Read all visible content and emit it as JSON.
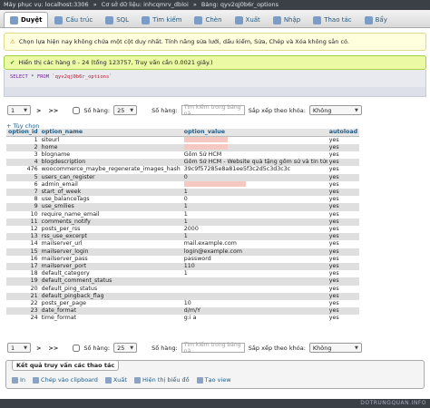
{
  "breadcrumb": {
    "server": "Máy phục vụ: localhost:3306",
    "database": "Cơ sở dữ liệu: inhcqmrv_dbloi",
    "table": "Bảng: qyv2qj0b6r_options",
    "sep": "»"
  },
  "tabs": [
    {
      "label": "Duyệt",
      "icon": "browse-icon"
    },
    {
      "label": "Cấu trúc",
      "icon": "structure-icon"
    },
    {
      "label": "SQL",
      "icon": "sql-icon"
    },
    {
      "label": "Tìm kiếm",
      "icon": "search-icon"
    },
    {
      "label": "Chèn",
      "icon": "insert-icon"
    },
    {
      "label": "Xuất",
      "icon": "export-icon"
    },
    {
      "label": "Nhập",
      "icon": "import-icon"
    },
    {
      "label": "Thao tác",
      "icon": "operations-icon"
    },
    {
      "label": "Bẩy",
      "icon": "triggers-icon"
    }
  ],
  "notice": "Chọn lựa hiện nay không chứa một cột duy nhất. Tính năng sửa lưới, dấu kiểm, Sửa, Chép và Xóa không sẵn có.",
  "success": "Hiển thị các hàng 0 - 24 (tổng 123757, Truy vấn cần 0.0021 giây.)",
  "sql_query": {
    "keyword1": "SELECT",
    "star": "*",
    "keyword2": "FROM",
    "table": "`qyv2qj0b6r_options`"
  },
  "nav": {
    "page": "1",
    "next": ">",
    "last": ">>",
    "rows_label": "Số hàng:",
    "rows_value": "25",
    "filter_label": "Số hàng:",
    "filter_placeholder": "Tìm kiếm trong bảng nà",
    "sort_label": "Sắp xếp theo khóa:",
    "sort_value": "Không"
  },
  "options_link": "+ Tùy chọn",
  "table": {
    "headers": [
      "option_id",
      "option_name",
      "option_value",
      "autoload"
    ],
    "rows": [
      {
        "id": "1",
        "name": "siteurl",
        "value": "",
        "redact": 0.6,
        "auto": "yes"
      },
      {
        "id": "2",
        "name": "home",
        "value": "",
        "redact": 0.6,
        "auto": "yes"
      },
      {
        "id": "3",
        "name": "blogname",
        "value": "Gốm Sứ HCM",
        "redact": 0,
        "auto": "yes"
      },
      {
        "id": "4",
        "name": "blogdescription",
        "value": "Gốm Sứ HCM - Website quà tặng gốm sứ và tin tức p...",
        "redact": 0,
        "auto": "yes"
      },
      {
        "id": "476",
        "name": "woocommerce_maybe_regenerate_images_hash",
        "value": "39c9f57285e8a81ee5f3c2d5c3d3c3c",
        "redact": 0,
        "auto": "yes"
      },
      {
        "id": "5",
        "name": "users_can_register",
        "value": "0",
        "redact": 0,
        "auto": "yes"
      },
      {
        "id": "6",
        "name": "admin_email",
        "value": "",
        "redact": 0.85,
        "auto": "yes"
      },
      {
        "id": "7",
        "name": "start_of_week",
        "value": "1",
        "redact": 0,
        "auto": "yes"
      },
      {
        "id": "8",
        "name": "use_balanceTags",
        "value": "0",
        "redact": 0,
        "auto": "yes"
      },
      {
        "id": "9",
        "name": "use_smilies",
        "value": "1",
        "redact": 0,
        "auto": "yes"
      },
      {
        "id": "10",
        "name": "require_name_email",
        "value": "1",
        "redact": 0,
        "auto": "yes"
      },
      {
        "id": "11",
        "name": "comments_notify",
        "value": "1",
        "redact": 0,
        "auto": "yes"
      },
      {
        "id": "12",
        "name": "posts_per_rss",
        "value": "2000",
        "redact": 0,
        "auto": "yes"
      },
      {
        "id": "13",
        "name": "rss_use_excerpt",
        "value": "1",
        "redact": 0,
        "auto": "yes"
      },
      {
        "id": "14",
        "name": "mailserver_url",
        "value": "mail.example.com",
        "redact": 0,
        "auto": "yes"
      },
      {
        "id": "15",
        "name": "mailserver_login",
        "value": "login@example.com",
        "redact": 0,
        "auto": "yes"
      },
      {
        "id": "16",
        "name": "mailserver_pass",
        "value": "password",
        "redact": 0,
        "auto": "yes"
      },
      {
        "id": "17",
        "name": "mailserver_port",
        "value": "110",
        "redact": 0,
        "auto": "yes"
      },
      {
        "id": "18",
        "name": "default_category",
        "value": "1",
        "redact": 0,
        "auto": "yes"
      },
      {
        "id": "19",
        "name": "default_comment_status",
        "value": "",
        "redact": 0,
        "auto": "yes"
      },
      {
        "id": "20",
        "name": "default_ping_status",
        "value": "",
        "redact": 0,
        "auto": "yes"
      },
      {
        "id": "21",
        "name": "default_pingback_flag",
        "value": "",
        "redact": 0,
        "auto": "yes"
      },
      {
        "id": "22",
        "name": "posts_per_page",
        "value": "10",
        "redact": 0,
        "auto": "yes"
      },
      {
        "id": "23",
        "name": "date_format",
        "value": "d/m/Y",
        "redact": 0,
        "auto": "yes"
      },
      {
        "id": "24",
        "name": "time_format",
        "value": "g:i a",
        "redact": 0,
        "auto": "yes"
      }
    ]
  },
  "results_ops": {
    "legend": "Kết quả truy vấn các thao tác",
    "items": [
      {
        "label": "In",
        "icon": "print-icon"
      },
      {
        "label": "Chép vào clipboard",
        "icon": "clipboard-icon"
      },
      {
        "label": "Xuất",
        "icon": "export-icon"
      },
      {
        "label": "Hiện thị biểu đồ",
        "icon": "chart-icon"
      },
      {
        "label": "Tạo view",
        "icon": "view-icon"
      }
    ]
  },
  "watermark": "DOTRUNGQUAN.INFO"
}
